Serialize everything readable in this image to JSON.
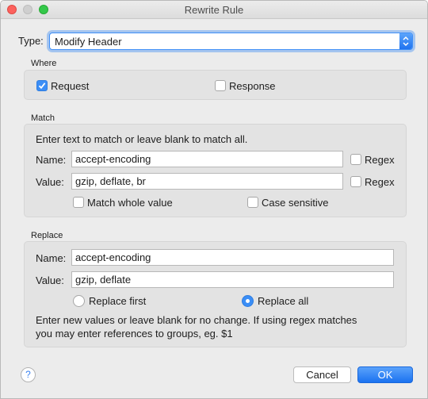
{
  "window": {
    "title": "Rewrite Rule"
  },
  "type": {
    "label": "Type:",
    "value": "Modify Header"
  },
  "where": {
    "title": "Where",
    "request": {
      "label": "Request",
      "checked": true
    },
    "response": {
      "label": "Response",
      "checked": false
    }
  },
  "match": {
    "title": "Match",
    "instructions": "Enter text to match or leave blank to match all.",
    "name_label": "Name:",
    "name_value": "accept-encoding",
    "name_regex_label": "Regex",
    "value_label": "Value:",
    "value_value": "gzip, deflate, br",
    "value_regex_label": "Regex",
    "whole_value_label": "Match whole value",
    "case_sensitive_label": "Case sensitive"
  },
  "replace": {
    "title": "Replace",
    "name_label": "Name:",
    "name_value": "accept-encoding",
    "value_label": "Value:",
    "value_value": "gzip, deflate",
    "replace_first_label": "Replace first",
    "replace_all_label": "Replace all",
    "selected_mode": "Replace all",
    "help_line1": "Enter new values or leave blank for no change. If using regex matches",
    "help_line2": "you may enter references to groups, eg. $1"
  },
  "footer": {
    "help_symbol": "?",
    "cancel_label": "Cancel",
    "ok_label": "OK"
  },
  "colors": {
    "accent": "#3b8ef6",
    "window_bg": "#ececec",
    "group_bg": "#e3e3e3"
  }
}
